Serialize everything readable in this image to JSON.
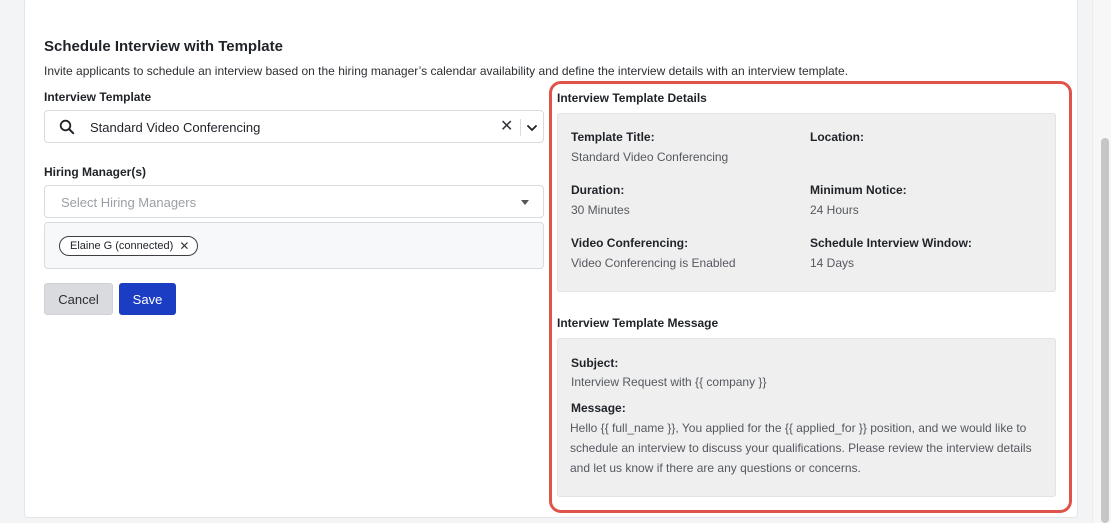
{
  "page": {
    "title": "Schedule Interview with Template",
    "description": "Invite applicants to schedule an interview based on the hiring manager’s calendar availability and define the interview details with an interview template."
  },
  "form": {
    "template_label": "Interview Template",
    "template_value": "Standard Video Conferencing",
    "clear_glyph": "✕",
    "managers_label": "Hiring Manager(s)",
    "managers_placeholder": "Select Hiring Managers",
    "selected_managers": [
      {
        "name": "Elaine G (connected)",
        "remove_glyph": "✕"
      }
    ],
    "cancel_label": "Cancel",
    "save_label": "Save"
  },
  "details": {
    "heading": "Interview Template Details",
    "template_title_label": "Template Title:",
    "template_title_value": "Standard Video Conferencing",
    "location_label": "Location:",
    "location_value": "",
    "duration_label": "Duration:",
    "duration_value": "30 Minutes",
    "notice_label": "Minimum Notice:",
    "notice_value": "24 Hours",
    "video_label": "Video Conferencing:",
    "video_value": "Video Conferencing is Enabled",
    "window_label": "Schedule Interview Window:",
    "window_value": "14 Days"
  },
  "message": {
    "heading": "Interview Template Message",
    "subject_label": "Subject:",
    "subject_value": "Interview Request with {{ company }}",
    "message_label": "Message:",
    "message_value": "Hello {{ full_name }}, You applied for the {{ applied_for }} position, and we would like to schedule an interview to discuss your qualifications. Please review the interview details and let us know if there are any questions or concerns."
  },
  "colors": {
    "primary": "#1a3dc4",
    "highlight": "#e0534a",
    "panel_bg": "#efeff0"
  },
  "icons": [
    "search-icon",
    "clear-icon",
    "chevron-down-icon",
    "caret-down-icon",
    "remove-chip-icon"
  ]
}
